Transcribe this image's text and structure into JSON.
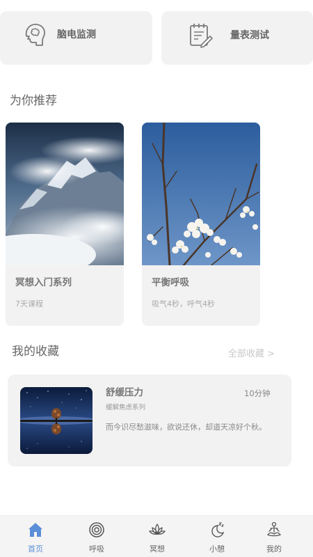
{
  "features": [
    {
      "label": "脑电监测",
      "icon": "head-brain-icon"
    },
    {
      "label": "量表测试",
      "icon": "clipboard-edit-icon"
    }
  ],
  "recommend": {
    "title": "为你推荐",
    "cards": [
      {
        "title": "冥想入门系列",
        "subtitle": "7天课程",
        "image": "snowy-mountain-image"
      },
      {
        "title": "平衡呼吸",
        "subtitle": "吸气4秒，呼气4秒",
        "image": "blossom-branch-image"
      }
    ]
  },
  "favorites": {
    "title": "我的收藏",
    "all_link": "全部收藏 >",
    "items": [
      {
        "title": "舒缓压力",
        "duration": "10分钟",
        "series": "缓解焦虑系列",
        "description": "而今识尽愁滋味，欲说还休，却道天凉好个秋。",
        "image": "night-tree-reflection-image"
      }
    ]
  },
  "tabbar": {
    "active_color": "#5a8fd8",
    "items": [
      {
        "label": "首页",
        "icon": "home-icon",
        "active": true
      },
      {
        "label": "呼吸",
        "icon": "breath-target-icon",
        "active": false
      },
      {
        "label": "冥想",
        "icon": "lotus-icon",
        "active": false
      },
      {
        "label": "小憩",
        "icon": "moon-sleep-icon",
        "active": false
      },
      {
        "label": "我的",
        "icon": "meditating-person-icon",
        "active": false
      }
    ]
  }
}
